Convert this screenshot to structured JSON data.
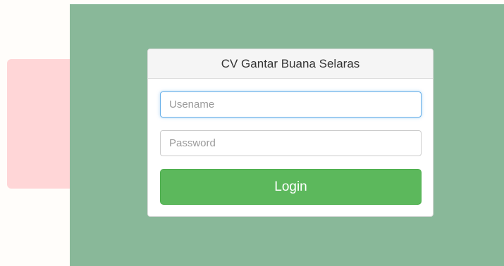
{
  "login": {
    "title": "CV Gantar Buana Selaras",
    "username_placeholder": "Usename",
    "username_value": "",
    "password_placeholder": "Password",
    "password_value": "",
    "login_label": "Login"
  },
  "colors": {
    "page_background": "#fffdfa",
    "panel_background": "#89b899",
    "accent_pink": "#ffd6d7",
    "button_green": "#5cb85c",
    "focus_blue": "#66afe9"
  }
}
